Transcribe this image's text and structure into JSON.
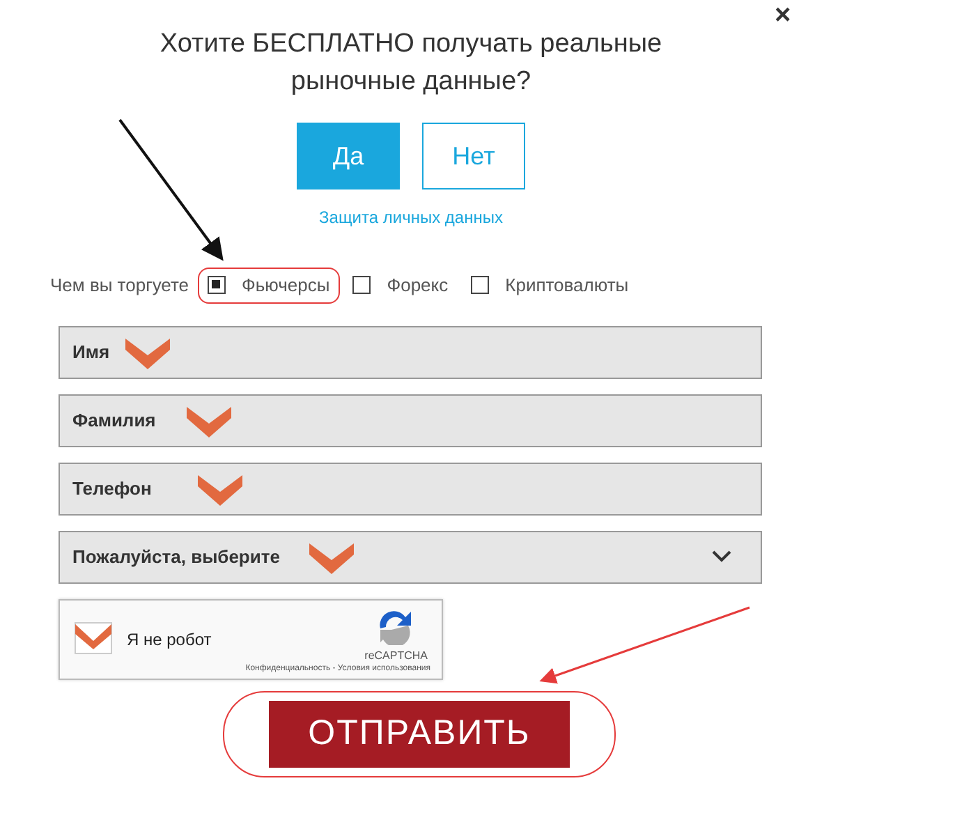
{
  "close": "×",
  "title": "Хотите БЕСПЛАТНО получать реальные рыночные данные?",
  "choices": [
    {
      "label": "Да",
      "selected": true
    },
    {
      "label": "Нет",
      "selected": false
    }
  ],
  "privacy_link": "Защита личных данных",
  "trade": {
    "label": "Чем вы торгуете",
    "options": [
      {
        "label": "Фьючерсы",
        "checked": true,
        "highlighted": true
      },
      {
        "label": "Форекс",
        "checked": false,
        "highlighted": false
      },
      {
        "label": "Криптовалюты",
        "checked": false,
        "highlighted": false
      }
    ]
  },
  "fields": [
    {
      "kind": "input",
      "placeholder": "Имя"
    },
    {
      "kind": "input",
      "placeholder": "Фамилия"
    },
    {
      "kind": "input",
      "placeholder": "Телефон"
    },
    {
      "kind": "select",
      "placeholder": "Пожалуйста, выберите"
    }
  ],
  "captcha": {
    "label": "Я не робот",
    "brand": "reCAPTCHA",
    "links": "Конфиденциальность - Условия использования"
  },
  "submit": {
    "label": "ОТПРАВИТЬ",
    "highlighted": true
  }
}
